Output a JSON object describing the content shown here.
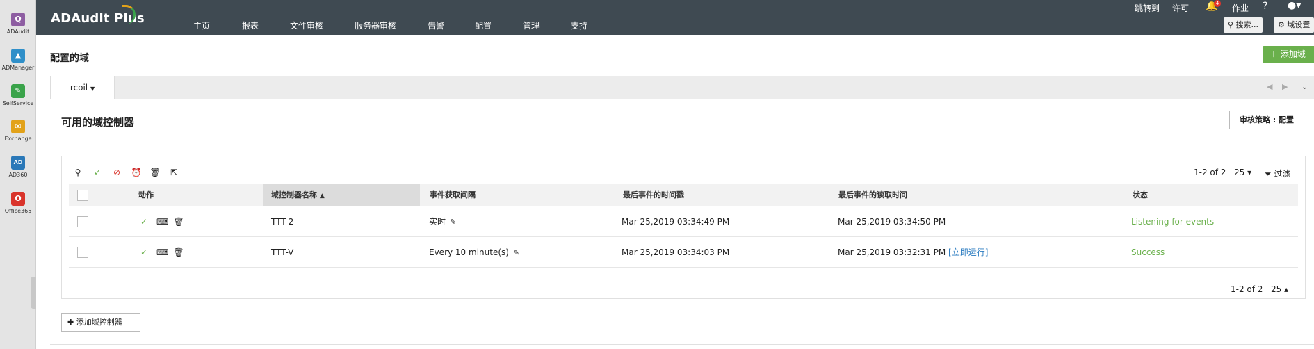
{
  "rail": {
    "items": [
      {
        "label": "ADAudit",
        "glyph": "Q",
        "color": "#8e5ea2"
      },
      {
        "label": "ADManager",
        "glyph": "▲",
        "color": "#2f8fc9"
      },
      {
        "label": "SelfService",
        "glyph": "✎",
        "color": "#3aa34a"
      },
      {
        "label": "Exchange",
        "glyph": "✉",
        "color": "#e2a21a"
      },
      {
        "label": "AD360",
        "glyph": "AD",
        "color": "#2a78b8"
      },
      {
        "label": "Office365",
        "glyph": "O",
        "color": "#d9342b"
      }
    ]
  },
  "header": {
    "logo": "ADAudit Plus",
    "nav": [
      "主页",
      "报表",
      "文件审核",
      "服务器审核",
      "告警",
      "配置",
      "管理",
      "支持"
    ],
    "jump_to": "跳转到",
    "license": "许可",
    "notification_count": "4",
    "jobs": "作业",
    "help": "?",
    "search_label": "搜索...",
    "domain_settings_label": "域设置"
  },
  "page": {
    "title": "配置的域",
    "add_domain": "添加域",
    "tab_domain": "rcoil",
    "section_title": "可用的域控制器",
    "audit_policy_button": "审核策略 : 配置"
  },
  "table": {
    "pager_count": "1-2 of 2",
    "page_size": "25",
    "filter_label": "过滤",
    "columns": {
      "action": "动作",
      "dc_name": "域控制器名称",
      "interval": "事件获取间隔",
      "last_event_time": "最后事件的时间戳",
      "last_read_time": "最后事件的读取时间",
      "status": "状态"
    },
    "rows": [
      {
        "dc_name": "TTT-2",
        "interval": "实时",
        "last_event_time": "Mar 25,2019 03:34:49 PM",
        "last_read_time": "Mar 25,2019 03:34:50 PM",
        "run_now": "",
        "status": "Listening for events"
      },
      {
        "dc_name": "TTT-V",
        "interval": "Every 10 minute(s)",
        "last_event_time": "Mar 25,2019 03:34:03 PM",
        "last_read_time": "Mar 25,2019 03:32:31 PM",
        "run_now": "[立即运行]",
        "status": "Success"
      }
    ]
  },
  "footer": {
    "add_dc_button": "添加域控制器"
  },
  "colors": {
    "topbar": "#3f4a52",
    "accent_green": "#6ab04c",
    "link_blue": "#2a7bc0"
  }
}
